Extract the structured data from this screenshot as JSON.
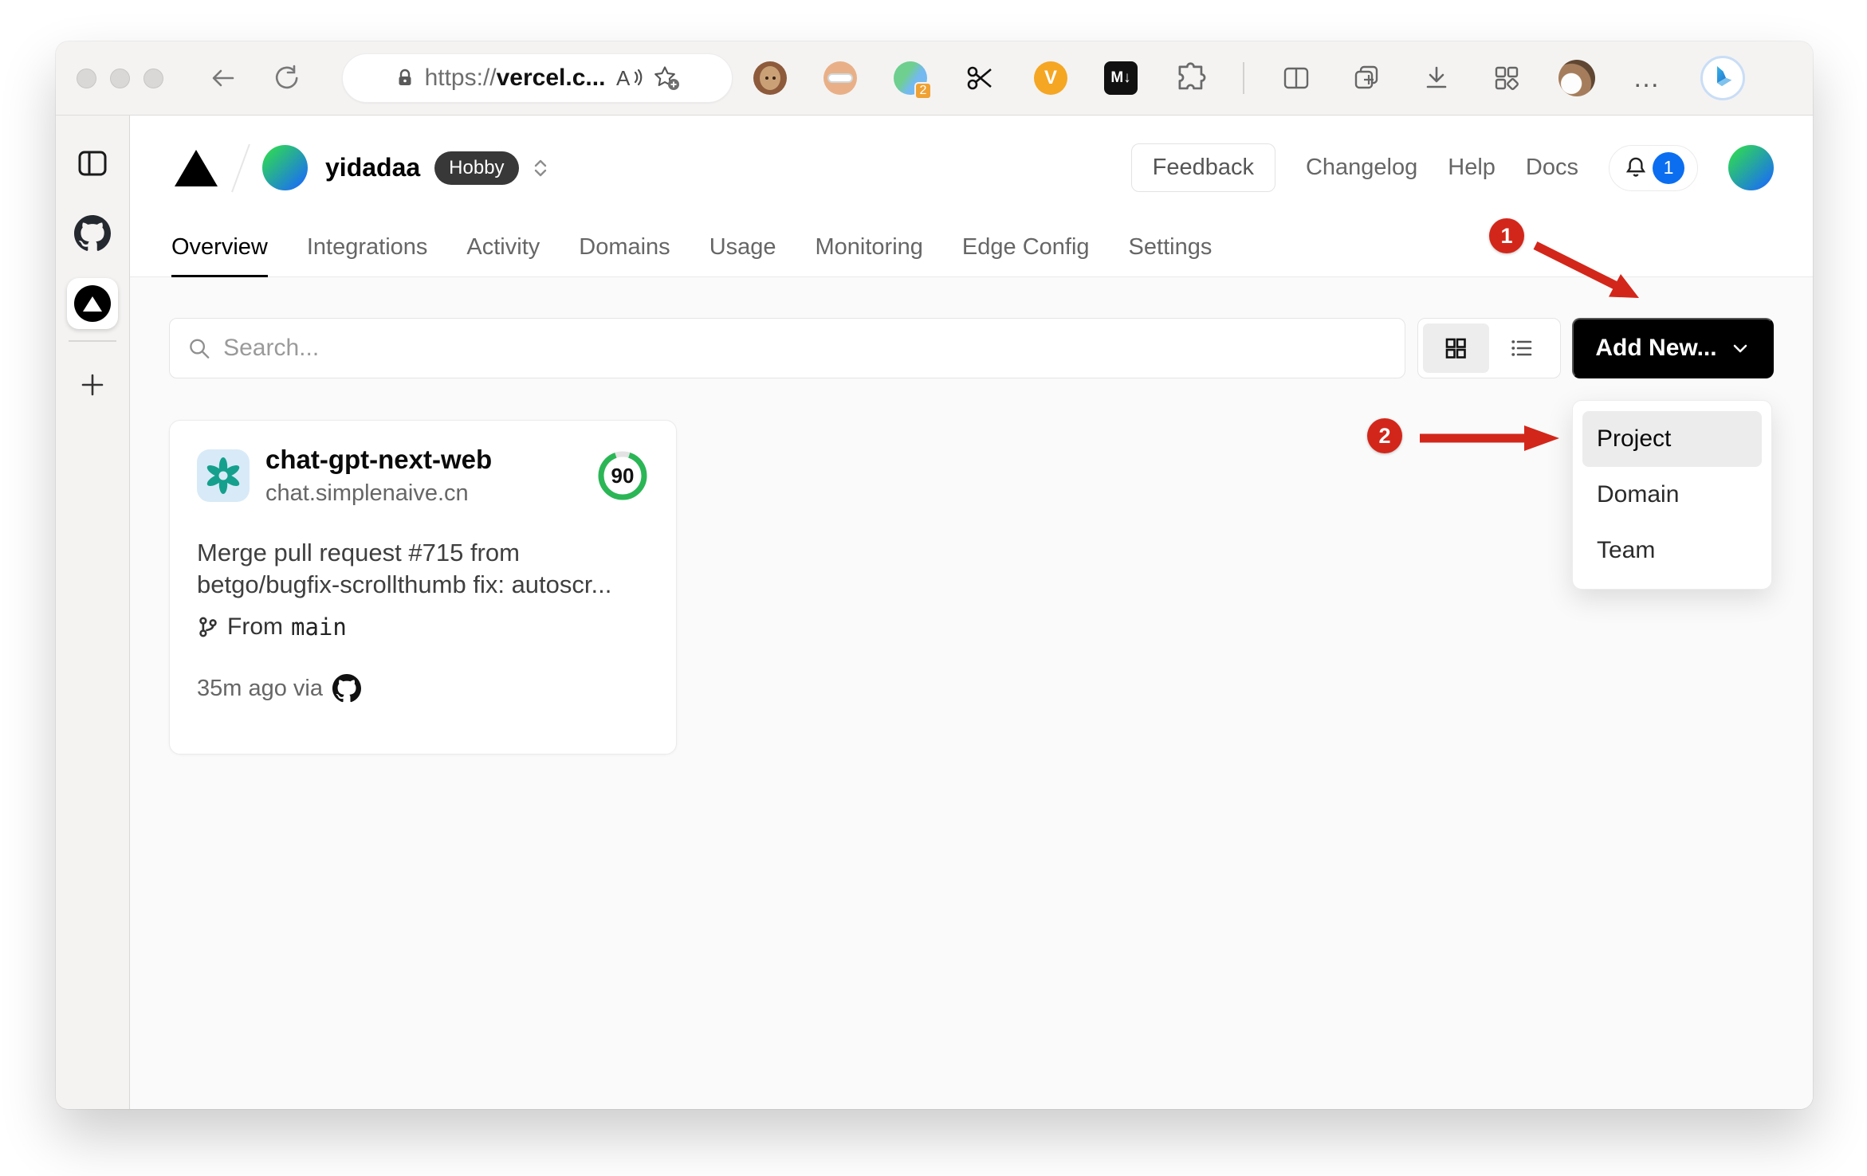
{
  "browser": {
    "url_prefix": "https://",
    "url_domain": "vercel.c...",
    "ext_badge": "2",
    "md_label": "M↓",
    "v_label": "V",
    "more": "…"
  },
  "vercel": {
    "header": {
      "team": "yidadaa",
      "plan": "Hobby",
      "feedback": "Feedback",
      "changelog": "Changelog",
      "help": "Help",
      "docs": "Docs",
      "notif": "1"
    },
    "tabs": [
      "Overview",
      "Integrations",
      "Activity",
      "Domains",
      "Usage",
      "Monitoring",
      "Edge Config",
      "Settings"
    ],
    "controls": {
      "search_placeholder": "Search...",
      "add_new": "Add New..."
    },
    "dropdown": [
      "Project",
      "Domain",
      "Team"
    ],
    "card": {
      "name": "chat-gpt-next-web",
      "domain": "chat.simplenaive.cn",
      "score": "90",
      "commit1": "Merge pull request #715 from",
      "commit2": "betgo/bugfix-scrollthumb fix: autoscr...",
      "from_label": "From",
      "branch": "main",
      "footer": "35m ago via"
    },
    "annotations": {
      "step1": "1",
      "step2": "2"
    }
  },
  "colors": {
    "accent_red": "#d3261a",
    "notification_blue": "#0b6ef0",
    "score_green": "#2bb656"
  }
}
